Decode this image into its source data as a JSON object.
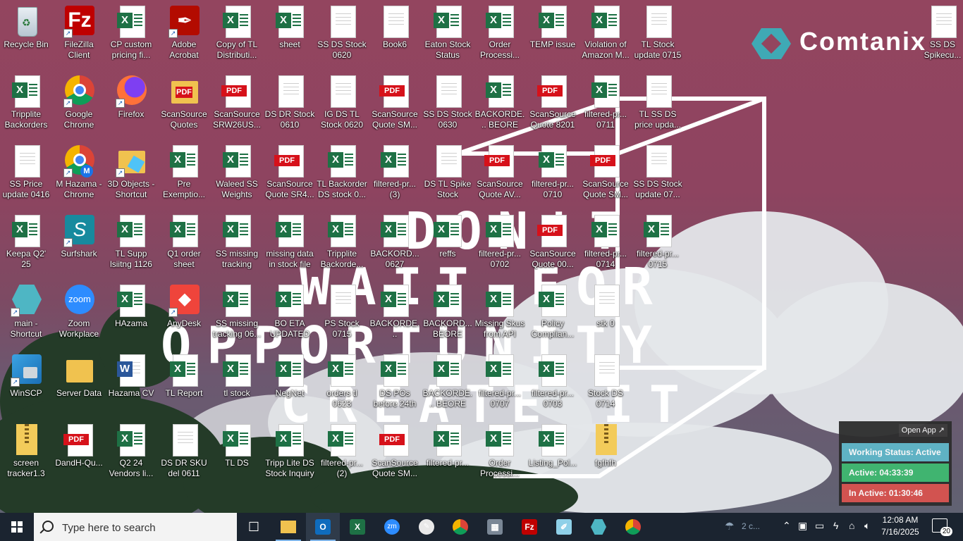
{
  "logo": {
    "name": "Comtanix"
  },
  "wallpaper": {
    "text_lines": [
      "DON'T",
      "WAIT FOR",
      "OPPORTUNITY",
      "CREATE IT"
    ]
  },
  "desktop": {
    "icons": [
      {
        "label": "Recycle Bin",
        "type": "recycle",
        "col": 0,
        "row": 0
      },
      {
        "label": "FileZilla Client",
        "type": "filezilla",
        "col": 1,
        "row": 0,
        "shortcut": true
      },
      {
        "label": "CP custom pricing fi...",
        "type": "excel",
        "col": 2,
        "row": 0
      },
      {
        "label": "Adobe Acrobat",
        "type": "acrobat",
        "col": 3,
        "row": 0,
        "shortcut": true
      },
      {
        "label": "Copy of TL Distributi...",
        "type": "excel",
        "col": 4,
        "row": 0
      },
      {
        "label": "sheet",
        "type": "excel",
        "col": 5,
        "row": 0
      },
      {
        "label": "SS DS Stock 0620",
        "type": "doc",
        "col": 6,
        "row": 0
      },
      {
        "label": "Book6",
        "type": "doc",
        "col": 7,
        "row": 0
      },
      {
        "label": "Eaton Stock Status",
        "type": "excel",
        "col": 8,
        "row": 0
      },
      {
        "label": "Order Processi...",
        "type": "excel",
        "col": 9,
        "row": 0
      },
      {
        "label": "TEMP issue",
        "type": "excel",
        "col": 10,
        "row": 0
      },
      {
        "label": "Violation of Amazon M...",
        "type": "excel",
        "col": 11,
        "row": 0
      },
      {
        "label": "TL Stock update 0715",
        "type": "doc",
        "col": 12,
        "row": 0
      },
      {
        "label": "SS DS Spikecu...",
        "type": "doc",
        "col": 17.4,
        "row": 0
      },
      {
        "label": "Tripplite Backorders",
        "type": "excel",
        "col": 0,
        "row": 1
      },
      {
        "label": "Google Chrome",
        "type": "chrome",
        "col": 1,
        "row": 1,
        "shortcut": true
      },
      {
        "label": "Firefox",
        "type": "firefox",
        "col": 2,
        "row": 1,
        "shortcut": true
      },
      {
        "label": "ScanSource Quotes",
        "type": "folderpdf",
        "col": 3,
        "row": 1
      },
      {
        "label": "ScanSource SRW26US...",
        "type": "pdf",
        "col": 4,
        "row": 1
      },
      {
        "label": "DS DR Stock 0610",
        "type": "doc",
        "col": 5,
        "row": 1
      },
      {
        "label": "IG DS TL Stock 0620",
        "type": "doc",
        "col": 6,
        "row": 1
      },
      {
        "label": "ScanSource Quote SM...",
        "type": "pdf",
        "col": 7,
        "row": 1
      },
      {
        "label": "SS DS Stock 0630",
        "type": "doc",
        "col": 8,
        "row": 1
      },
      {
        "label": "BACKORDE... BEORE 23R...",
        "type": "excel",
        "col": 9,
        "row": 1
      },
      {
        "label": "ScanSource Quote 8201",
        "type": "pdf",
        "col": 10,
        "row": 1
      },
      {
        "label": "filtered-pr... 0711",
        "type": "excel",
        "col": 11,
        "row": 1
      },
      {
        "label": "TL SS DS price upda...",
        "type": "doc",
        "col": 12,
        "row": 1
      },
      {
        "label": "SS Price update 0416",
        "type": "doc",
        "col": 0,
        "row": 2
      },
      {
        "label": "M Hazama - Chrome",
        "type": "chromem",
        "col": 1,
        "row": 2,
        "shortcut": true
      },
      {
        "label": "3D Objects - Shortcut",
        "type": "folder3d",
        "col": 2,
        "row": 2,
        "shortcut": true
      },
      {
        "label": "Pre Exemptio...",
        "type": "excel",
        "col": 3,
        "row": 2
      },
      {
        "label": "Waleed SS Weights",
        "type": "excel",
        "col": 4,
        "row": 2
      },
      {
        "label": "ScanSource Quote SR4...",
        "type": "pdf",
        "col": 5,
        "row": 2
      },
      {
        "label": "TL Backorder DS stock 0...",
        "type": "excel",
        "col": 6,
        "row": 2
      },
      {
        "label": "filtered-pr... (3)",
        "type": "excel",
        "col": 7,
        "row": 2
      },
      {
        "label": "DS TL Spike Stock",
        "type": "doc",
        "col": 8,
        "row": 2
      },
      {
        "label": "ScanSource Quote AV...",
        "type": "pdf",
        "col": 9,
        "row": 2
      },
      {
        "label": "filtered-pr... 0710",
        "type": "excel",
        "col": 10,
        "row": 2
      },
      {
        "label": "ScanSource Quote SM...",
        "type": "pdf",
        "col": 11,
        "row": 2
      },
      {
        "label": "SS DS Stock update 07...",
        "type": "doc",
        "col": 12,
        "row": 2
      },
      {
        "label": "Keepa Q2' 25",
        "type": "excel",
        "col": 0,
        "row": 3
      },
      {
        "label": "Surfshark",
        "type": "surfshark",
        "col": 1,
        "row": 3,
        "shortcut": true
      },
      {
        "label": "TL Supp lsiitng 1126",
        "type": "excel",
        "col": 2,
        "row": 3
      },
      {
        "label": "Q1 order sheet",
        "type": "excel",
        "col": 3,
        "row": 3
      },
      {
        "label": "SS missing tracking 0610",
        "type": "excel",
        "col": 4,
        "row": 3
      },
      {
        "label": "missing data in stock file",
        "type": "excel",
        "col": 5,
        "row": 3
      },
      {
        "label": "Tripplite Backorde...",
        "type": "excel",
        "col": 6,
        "row": 3
      },
      {
        "label": "BACKORD... 0627",
        "type": "excel",
        "col": 7,
        "row": 3
      },
      {
        "label": "reffs",
        "type": "excel",
        "col": 8,
        "row": 3
      },
      {
        "label": "filtered-pr... 0702",
        "type": "excel",
        "col": 9,
        "row": 3
      },
      {
        "label": "ScanSource Quote 00...",
        "type": "pdf",
        "col": 10,
        "row": 3
      },
      {
        "label": "filtered-pr... 0714",
        "type": "excel",
        "col": 11,
        "row": 3
      },
      {
        "label": "filtered-pr... 0715",
        "type": "excel",
        "col": 12,
        "row": 3
      },
      {
        "label": "main - Shortcut",
        "type": "hexapp",
        "col": 0,
        "row": 4,
        "shortcut": true
      },
      {
        "label": "Zoom Workplace",
        "type": "zoom",
        "col": 1,
        "row": 4
      },
      {
        "label": "HAzama",
        "type": "excel",
        "col": 2,
        "row": 4
      },
      {
        "label": "AnyDesk",
        "type": "anydesk",
        "col": 3,
        "row": 4,
        "shortcut": true
      },
      {
        "label": "SS missing tracking 06...",
        "type": "excel",
        "col": 4,
        "row": 4
      },
      {
        "label": "BO ETA UPDATED",
        "type": "excel",
        "col": 5,
        "row": 4
      },
      {
        "label": "PS Stock 0715",
        "type": "doc",
        "col": 6,
        "row": 4
      },
      {
        "label": "BACKORDE... 0627(20250...",
        "type": "excel",
        "col": 7,
        "row": 4
      },
      {
        "label": "BACKORD... BEORE 23R...",
        "type": "excel",
        "col": 8,
        "row": 4
      },
      {
        "label": "Missing Skus from API",
        "type": "excel",
        "col": 9,
        "row": 4
      },
      {
        "label": "Policy Complian...",
        "type": "excel",
        "col": 10,
        "row": 4
      },
      {
        "label": "stk 0",
        "type": "doc",
        "col": 11,
        "row": 4
      },
      {
        "label": "WinSCP",
        "type": "winscp",
        "col": 0,
        "row": 5,
        "shortcut": true
      },
      {
        "label": "Server Data",
        "type": "folder",
        "col": 1,
        "row": 5
      },
      {
        "label": "Hazama CV",
        "type": "word",
        "col": 2,
        "row": 5
      },
      {
        "label": "TL Report",
        "type": "excel",
        "col": 3,
        "row": 5
      },
      {
        "label": "tl stock",
        "type": "excel",
        "col": 4,
        "row": 5
      },
      {
        "label": "NegNet",
        "type": "excel",
        "col": 5,
        "row": 5
      },
      {
        "label": "orders tl 0623",
        "type": "excel",
        "col": 6,
        "row": 5
      },
      {
        "label": "DS POs before 24th",
        "type": "excel",
        "col": 7,
        "row": 5
      },
      {
        "label": "BACKORDE... BEORE 23R...",
        "type": "excel",
        "col": 8,
        "row": 5
      },
      {
        "label": "filtered-pr... 0707",
        "type": "excel",
        "col": 9,
        "row": 5
      },
      {
        "label": "filtered-pr... 0703",
        "type": "excel",
        "col": 10,
        "row": 5
      },
      {
        "label": "Stock DS 0714",
        "type": "doc",
        "col": 11,
        "row": 5
      },
      {
        "label": "screen tracker1.3",
        "type": "zip",
        "col": 0,
        "row": 6
      },
      {
        "label": "DandH-Qu...",
        "type": "pdf",
        "col": 1,
        "row": 6
      },
      {
        "label": "Q2 24 Vendors li...",
        "type": "excel",
        "col": 2,
        "row": 6
      },
      {
        "label": "DS DR SKU del 0611",
        "type": "doc",
        "col": 3,
        "row": 6
      },
      {
        "label": "TL DS",
        "type": "excel",
        "col": 4,
        "row": 6
      },
      {
        "label": "Tripp Lite DS Stock Inquiry",
        "type": "excel",
        "col": 5,
        "row": 6
      },
      {
        "label": "filtered-pr... (2)",
        "type": "excel",
        "col": 6,
        "row": 6
      },
      {
        "label": "ScanSource Quote SM...",
        "type": "pdf",
        "col": 7,
        "row": 6
      },
      {
        "label": "filtered-pr...",
        "type": "excel",
        "col": 8,
        "row": 6
      },
      {
        "label": "Order Processi...",
        "type": "excel",
        "col": 9,
        "row": 6
      },
      {
        "label": "Listing_Pol...",
        "type": "excel",
        "col": 10,
        "row": 6
      },
      {
        "label": "fgfhfh",
        "type": "zip",
        "col": 11,
        "row": 6
      }
    ]
  },
  "tracker": {
    "open_label": "Open App ↗",
    "status": "Working Status: Active",
    "active": "Active: 04:33:39",
    "inactive": "In Active: 01:30:46",
    "colors": {
      "status": "#5fb7c9",
      "active": "#3fb970",
      "inactive": "#d9534f"
    }
  },
  "taskbar": {
    "search_placeholder": "Type here to search",
    "apps": [
      {
        "name": "task-view-icon",
        "active": false
      },
      {
        "name": "file-explorer-icon",
        "active": false
      },
      {
        "name": "outlook-icon",
        "active": true
      },
      {
        "name": "excel-icon",
        "active": false
      },
      {
        "name": "zoom-icon",
        "active": false
      },
      {
        "name": "paint-icon",
        "active": false
      },
      {
        "name": "chrome-profile-icon",
        "active": false
      },
      {
        "name": "calculator-icon",
        "active": false
      },
      {
        "name": "filezilla-icon",
        "active": false
      },
      {
        "name": "notepad-icon",
        "active": false
      },
      {
        "name": "hex-app-icon",
        "active": false
      },
      {
        "name": "chrome-icon",
        "active": false
      }
    ],
    "weather": "2 c...",
    "time": "12:08 AM",
    "date": "7/16/2025",
    "notification_count": "20"
  }
}
